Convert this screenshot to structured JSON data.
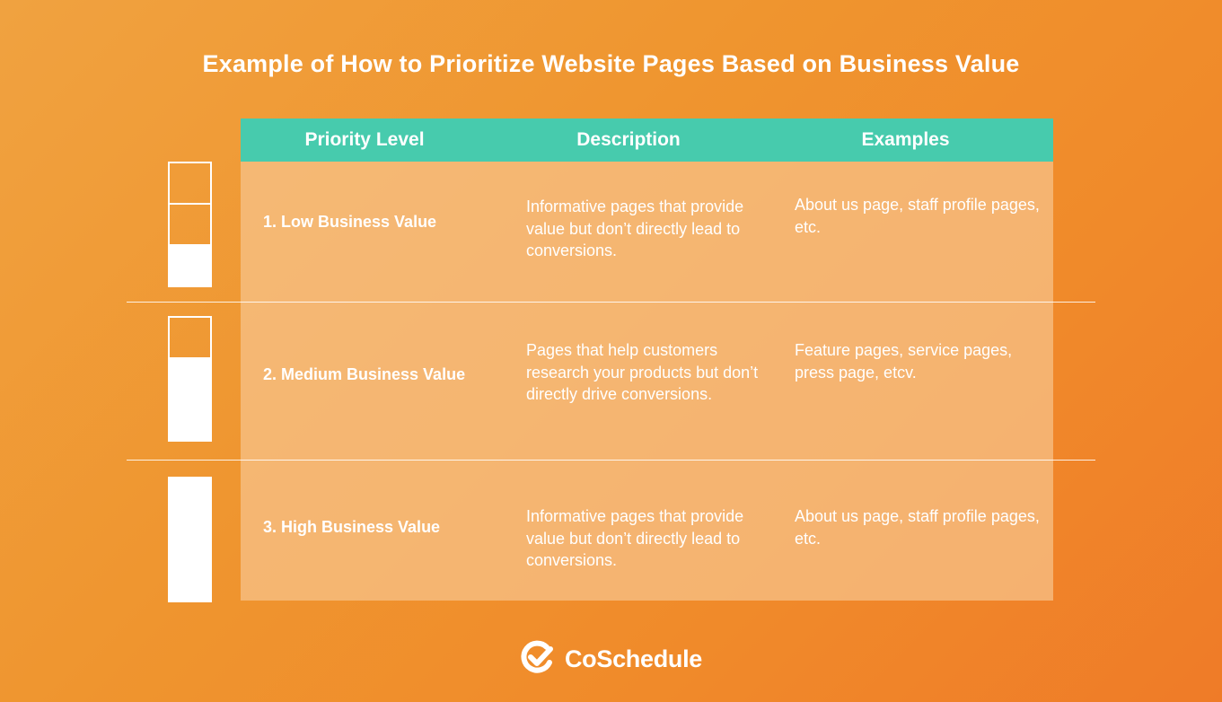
{
  "title": "Example of How to Prioritize Website Pages Based on Business Value",
  "colors": {
    "background": "#f0962f",
    "header": "#47cbad",
    "panel": "#f5b977",
    "text": "#ffffff"
  },
  "table": {
    "headers": [
      "Priority Level",
      "Description",
      "Examples"
    ],
    "rows": [
      {
        "level": "1. Low Business Value",
        "description": "Informative pages that provide value but don’t directly lead to conversions.",
        "examples": "About us page, staff profile pages, etc.",
        "meter_filled": 1,
        "meter_total": 3
      },
      {
        "level": "2. Medium Business Value",
        "description": "Pages that help customers research your products but don’t directly drive conversions.",
        "examples": "Feature pages, service pages, press page, etcv.",
        "meter_filled": 2,
        "meter_total": 3
      },
      {
        "level": "3. High Business Value",
        "description": "Informative pages that provide value but don’t directly lead to conversions.",
        "examples": "About us page, staff profile pages, etc.",
        "meter_filled": 3,
        "meter_total": 3
      }
    ]
  },
  "brand": {
    "name": "CoSchedule",
    "icon": "coschedule-check-logo-icon"
  }
}
